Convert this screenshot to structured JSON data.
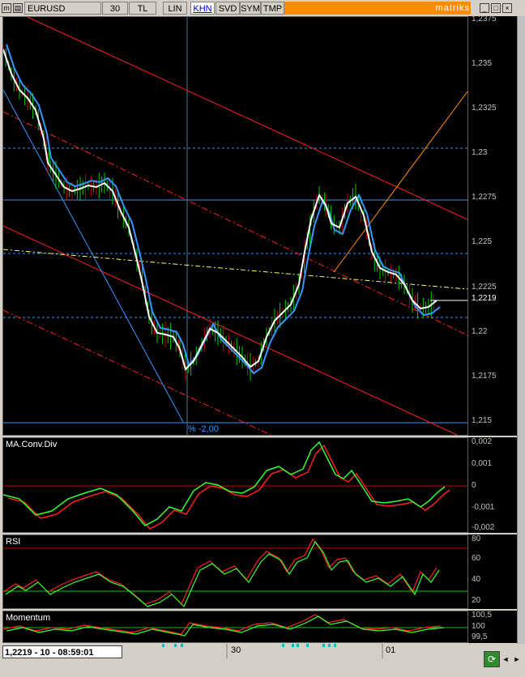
{
  "toolbar": {
    "symbol": "EURUSD",
    "period": "30",
    "buttons": [
      "TL",
      "LIN",
      "KHN",
      "SVD",
      "SYM",
      "TMP"
    ],
    "active_button": "KHN",
    "brand": "matriks"
  },
  "main_chart": {
    "y_ticks": [
      "1,2375",
      "1,235",
      "1,2325",
      "1,23",
      "1,2275",
      "1,225",
      "1,2225",
      "1,22",
      "1,2175",
      "1,215"
    ],
    "last_price": "1,2219",
    "annotation": "% -2,00",
    "colors": {
      "price": "#00cc00",
      "price_down": "#cc0000",
      "ma_fast": "#ffffff",
      "ma_slow": "#3399ff",
      "channel": "#ff2020",
      "trend_up": "#ff8c00",
      "trend_down": "#3399ff",
      "level_line": "#ffff66"
    }
  },
  "macd": {
    "title": "MA.Conv.Div",
    "y_ticks": [
      "0,002",
      "0,001",
      "0",
      "-0,001",
      "-0,002"
    ]
  },
  "rsi": {
    "title": "RSI",
    "y_ticks": [
      "80",
      "60",
      "40",
      "20"
    ]
  },
  "momentum": {
    "title": "Momentum",
    "y_ticks": [
      "100,5",
      "100",
      "99,5"
    ]
  },
  "status": {
    "readout": "1,2219 - 10 - 08:59:01"
  },
  "x_axis": {
    "date_labels": [
      "30",
      "01"
    ]
  }
}
